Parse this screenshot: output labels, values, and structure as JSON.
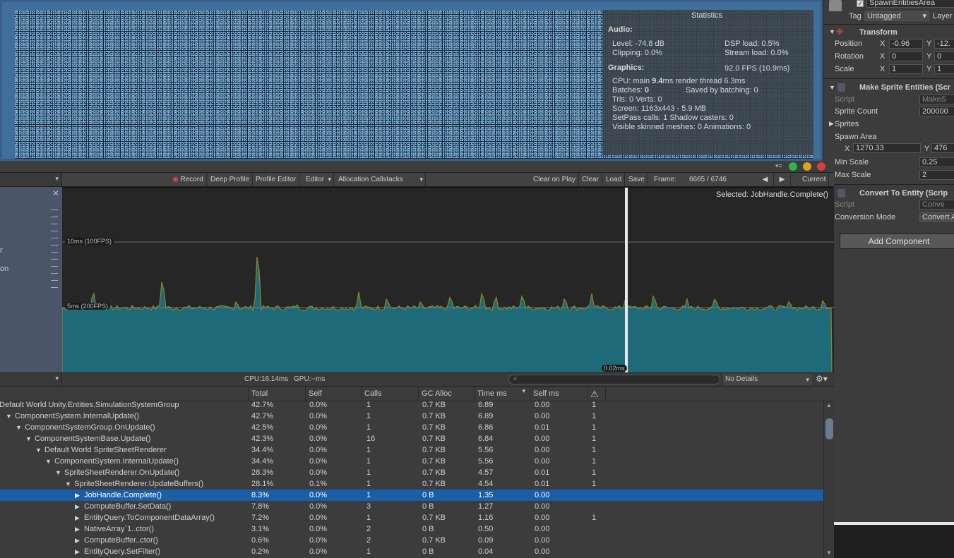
{
  "colors": {
    "accent_blue": "#1a5ea8",
    "graph_fill": "#1e6a78",
    "graph_line": "#8a8a20",
    "game_bg": "#0d1a2a"
  },
  "statistics": {
    "title": "Statistics",
    "audio_header": "Audio:",
    "level": "Level: -74.8 dB",
    "dsp": "DSP load: 0.5%",
    "clipping": "Clipping: 0.0%",
    "stream": "Stream load: 0.0%",
    "graphics_header": "Graphics:",
    "fps": "92.0 FPS (10.9ms)",
    "cpu_prefix": "CPU: main ",
    "cpu_main": "9.4",
    "cpu_suffix": "ms  render thread 6.3ms",
    "batches_prefix": "Batches: ",
    "batches": "0",
    "saved": "Saved by batching: 0",
    "tris": "Tris: 0     Verts: 0",
    "screen": "Screen: 1163x443 - 5.9 MB",
    "setpass": "SetPass calls: 1       Shadow casters: 0",
    "skinned": "Visible skinned meshes: 0  Animations: 0"
  },
  "inspector": {
    "object_name": "SpawnEntitiesArea",
    "tag_label": "Tag",
    "tag_value": "Untagged",
    "layer_label": "Layer",
    "transform": "Transform",
    "position": "Position",
    "rotation": "Rotation",
    "scale": "Scale",
    "x": "X",
    "y": "Y",
    "pos_x": "-0.96",
    "pos_y": "-12.",
    "rot_x": "0",
    "rot_y": "0",
    "scale_x": "1",
    "scale_y": "1",
    "make_sprite": "Make Sprite Entities (Scr",
    "script_label": "Script",
    "script_value": "MakeS",
    "sprite_count_label": "Sprite Count",
    "sprite_count": "200000",
    "sprites_label": "Sprites",
    "spawn_area_label": "Spawn Area",
    "spawn_x": "1270.33",
    "spawn_y": "476",
    "min_scale_label": "Min Scale",
    "min_scale": "0.25",
    "max_scale_label": "Max Scale",
    "max_scale": "2",
    "convert": "Convert To Entity (Scrip",
    "script2_value": "Conve",
    "conversion_label": "Conversion Mode",
    "conversion_value": "Convert A",
    "add_component": "Add Component"
  },
  "toolbar": {
    "record": "Record",
    "deep_profile": "Deep Profile",
    "profile_editor": "Profile Editor",
    "editor": "Editor",
    "allocation": "Allocation Callstacks",
    "clear_on_play": "Clear on Play",
    "clear": "Clear",
    "load": "Load",
    "save": "Save",
    "frame_label": "Frame:",
    "frame_value": "6665 / 6746",
    "current": "Current"
  },
  "chart": {
    "selected": "Selected: JobHandle.Complete()",
    "line_10ms": "10ms (100FPS)",
    "line_5ms": "5ms (200FPS)",
    "cursor_label": "0.02ms"
  },
  "midbar": {
    "cpu": "CPU:16.14ms",
    "gpu": "GPU:--ms",
    "details": "No Details"
  },
  "columns": [
    "Total",
    "Self",
    "Calls",
    "GC Alloc",
    "Time ms",
    "Self ms"
  ],
  "rows": [
    {
      "name": "Default World Unity.Entities.SimulationSystemGroup",
      "indent": 0,
      "arrow": "",
      "total": "42.7%",
      "self": "0.0%",
      "calls": "1",
      "gc": "0.7 KB",
      "time": "6.89",
      "selfms": "0.00",
      "warn": "1"
    },
    {
      "name": "ComponentSystem.InternalUpdate()",
      "indent": 1,
      "arrow": "▼",
      "total": "42.7%",
      "self": "0.0%",
      "calls": "1",
      "gc": "0.7 KB",
      "time": "6.89",
      "selfms": "0.00",
      "warn": "1"
    },
    {
      "name": "ComponentSystemGroup.OnUpdate()",
      "indent": 2,
      "arrow": "▼",
      "total": "42.5%",
      "self": "0.0%",
      "calls": "1",
      "gc": "0.7 KB",
      "time": "6.86",
      "selfms": "0.01",
      "warn": "1"
    },
    {
      "name": "ComponentSystemBase.Update()",
      "indent": 3,
      "arrow": "▼",
      "total": "42.3%",
      "self": "0.0%",
      "calls": "16",
      "gc": "0.7 KB",
      "time": "6.84",
      "selfms": "0.00",
      "warn": "1"
    },
    {
      "name": "Default World SpriteSheetRenderer",
      "indent": 4,
      "arrow": "▼",
      "total": "34.4%",
      "self": "0.0%",
      "calls": "1",
      "gc": "0.7 KB",
      "time": "5.56",
      "selfms": "0.00",
      "warn": "1"
    },
    {
      "name": "ComponentSystem.InternalUpdate()",
      "indent": 5,
      "arrow": "▼",
      "total": "34.4%",
      "self": "0.0%",
      "calls": "1",
      "gc": "0.7 KB",
      "time": "5.56",
      "selfms": "0.00",
      "warn": "1"
    },
    {
      "name": "SpriteSheetRenderer.OnUpdate()",
      "indent": 6,
      "arrow": "▼",
      "total": "28.3%",
      "self": "0.0%",
      "calls": "1",
      "gc": "0.7 KB",
      "time": "4.57",
      "selfms": "0.01",
      "warn": "1"
    },
    {
      "name": "SpriteSheetRenderer.UpdateBuffers()",
      "indent": 7,
      "arrow": "▼",
      "total": "28.1%",
      "self": "0.1%",
      "calls": "1",
      "gc": "0.7 KB",
      "time": "4.54",
      "selfms": "0.01",
      "warn": "1"
    },
    {
      "name": "JobHandle.Complete()",
      "indent": 8,
      "arrow": "▶",
      "total": "8.3%",
      "self": "0.0%",
      "calls": "1",
      "gc": "0 B",
      "time": "1.35",
      "selfms": "0.00",
      "warn": "",
      "selected": true
    },
    {
      "name": "ComputeBuffer.SetData()",
      "indent": 8,
      "arrow": "▶",
      "total": "7.8%",
      "self": "0.0%",
      "calls": "3",
      "gc": "0 B",
      "time": "1.27",
      "selfms": "0.00",
      "warn": ""
    },
    {
      "name": "EntityQuery.ToComponentDataArray()",
      "indent": 8,
      "arrow": "▶",
      "total": "7.2%",
      "self": "0.0%",
      "calls": "1",
      "gc": "0.7 KB",
      "time": "1.16",
      "selfms": "0.00",
      "warn": "1"
    },
    {
      "name": "NativeArray`1..ctor()",
      "indent": 8,
      "arrow": "▶",
      "total": "3.1%",
      "self": "0.0%",
      "calls": "2",
      "gc": "0 B",
      "time": "0.50",
      "selfms": "0.00",
      "warn": ""
    },
    {
      "name": "ComputeBuffer..ctor()",
      "indent": 8,
      "arrow": "▶",
      "total": "0.6%",
      "self": "0.0%",
      "calls": "2",
      "gc": "0.7 KB",
      "time": "0.09",
      "selfms": "0.00",
      "warn": ""
    },
    {
      "name": "EntityQuery.SetFilter()",
      "indent": 8,
      "arrow": "▶",
      "total": "0.2%",
      "self": "0.0%",
      "calls": "1",
      "gc": "0 B",
      "time": "0.04",
      "selfms": "0.00",
      "warn": ""
    }
  ]
}
